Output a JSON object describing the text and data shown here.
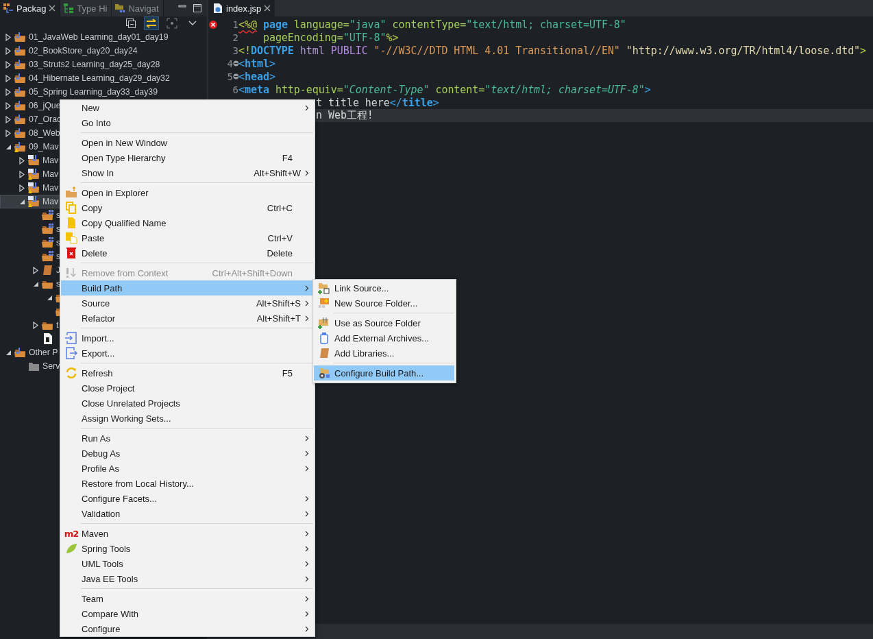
{
  "package_explorer": {
    "tabs": [
      {
        "label": "Packag",
        "selected": true,
        "closable": true
      },
      {
        "label": "Type Hi",
        "selected": false,
        "closable": false
      },
      {
        "label": "Navigat",
        "selected": false,
        "closable": false
      }
    ],
    "toolbar": [
      {
        "kind": "collapse",
        "selected": false
      },
      {
        "kind": "link",
        "selected": true
      },
      {
        "kind": "focus",
        "selected": false
      },
      {
        "kind": "menu",
        "selected": false
      }
    ],
    "tree": [
      {
        "name": "01_JavaWeb Learning_day01_day19",
        "kind": "project",
        "expanded": false,
        "selected": false
      },
      {
        "name": "02_BookStore_day20_day24",
        "kind": "project",
        "expanded": false,
        "selected": false
      },
      {
        "name": "03_Struts2 Learning_day25_day28",
        "kind": "project",
        "expanded": false,
        "selected": false
      },
      {
        "name": "04_Hibernate Learning_day29_day32",
        "kind": "project",
        "expanded": false,
        "selected": false
      },
      {
        "name": "05_Spring Learning_day33_day39",
        "kind": "project",
        "expanded": false,
        "selected": false
      },
      {
        "name": "06_jQue",
        "kind": "project",
        "expanded": false,
        "selected": false
      },
      {
        "name": "07_Orac",
        "kind": "project",
        "expanded": false,
        "selected": false
      },
      {
        "name": "08_Web",
        "kind": "project",
        "expanded": false,
        "selected": false
      },
      {
        "name": "09_Mav",
        "kind": "project",
        "warning": true,
        "expanded": true,
        "selected": false,
        "children": [
          {
            "name": "Mav",
            "kind": "maven",
            "warning": false,
            "expanded": false,
            "selected": false
          },
          {
            "name": "Mav",
            "kind": "maven",
            "warning": true,
            "expanded": false,
            "selected": false
          },
          {
            "name": "Mav",
            "kind": "maven",
            "warning": true,
            "expanded": false,
            "selected": false
          },
          {
            "name": "Mav",
            "kind": "maven",
            "warning": true,
            "expanded": true,
            "selected": true,
            "children": [
              {
                "name": "s",
                "kind": "source-folder",
                "selected": false
              },
              {
                "name": "s",
                "kind": "source-folder",
                "selected": false
              },
              {
                "name": "s",
                "kind": "source-folder",
                "selected": false
              },
              {
                "name": "s",
                "kind": "source-folder",
                "selected": false
              },
              {
                "name": "J",
                "kind": "library",
                "expanded": false,
                "selected": false
              },
              {
                "name": "s",
                "kind": "folder",
                "expanded": true,
                "selected": false,
                "children": [
                  {
                    "kind": "folder",
                    "expanded": true,
                    "selected": false
                  },
                  {
                    "kind": "folder",
                    "selected": false
                  }
                ]
              },
              {
                "name": "t",
                "kind": "folder",
                "expanded": false,
                "selected": false
              },
              {
                "kind": "file",
                "selected": false
              }
            ]
          }
        ]
      },
      {
        "name": "Other P",
        "kind": "project",
        "expanded": true,
        "selected": false,
        "children": [
          {
            "name": "Serv",
            "kind": "grey-folder",
            "selected": false
          }
        ]
      }
    ]
  },
  "editor": {
    "tabs": [
      {
        "label": "index.jsp",
        "selected": true
      }
    ],
    "lines": [
      {
        "kind": "full",
        "number": "1",
        "error": true,
        "foldable": false,
        "current": false,
        "tokens": [
          {
            "t": "<%@",
            "kind": "delim"
          },
          {
            "t": " page",
            "kind": "keyword"
          },
          {
            "t": " language=",
            "kind": "attr"
          },
          {
            "t": "\"java\"",
            "kind": "value"
          },
          {
            "t": " contentType=",
            "kind": "attr"
          },
          {
            "t": "\"text/html; charset=UTF-8\"",
            "kind": "value"
          }
        ]
      },
      {
        "kind": "full",
        "number": "2",
        "error": false,
        "foldable": false,
        "current": false,
        "tokens": [
          {
            "t": "    pageEncoding=",
            "kind": "attr"
          },
          {
            "t": "\"UTF-8\"",
            "kind": "value"
          },
          {
            "t": "%>",
            "kind": "delim"
          }
        ]
      },
      {
        "kind": "full",
        "number": "3",
        "error": false,
        "foldable": false,
        "current": false,
        "tokens": [
          {
            "t": "<!",
            "kind": "delim"
          },
          {
            "t": "DOCTYPE",
            "kind": "keyword"
          },
          {
            "t": " html",
            "kind": "doctype"
          },
          {
            "t": " PUBLIC",
            "kind": "public"
          },
          {
            "t": " \"-//W3C//DTD HTML 4.01 Transitional//EN\"",
            "kind": "string"
          },
          {
            "t": " \"http://www.w3.org/TR/html4/loose.dtd\"",
            "kind": "url"
          },
          {
            "t": ">",
            "kind": "delim"
          }
        ]
      },
      {
        "kind": "full",
        "number": "4",
        "error": false,
        "foldable": true,
        "current": false,
        "tokens": [
          {
            "t": "<",
            "kind": "bracket"
          },
          {
            "t": "html",
            "kind": "tag"
          },
          {
            "t": ">",
            "kind": "bracket"
          }
        ]
      },
      {
        "kind": "full",
        "number": "5",
        "error": false,
        "foldable": true,
        "current": false,
        "tokens": [
          {
            "t": "<",
            "kind": "bracket"
          },
          {
            "t": "head",
            "kind": "tag"
          },
          {
            "t": ">",
            "kind": "bracket"
          }
        ]
      },
      {
        "kind": "full",
        "number": "6",
        "error": false,
        "foldable": false,
        "current": false,
        "tokens": [
          {
            "t": "<",
            "kind": "bracket"
          },
          {
            "t": "meta",
            "kind": "tag"
          },
          {
            "t": " http-equiv=",
            "kind": "attr"
          },
          {
            "t": "\"Content-Type\"",
            "kind": "ivalue"
          },
          {
            "t": " content=",
            "kind": "attr"
          },
          {
            "t": "\"text/html; charset=UTF-8\"",
            "kind": "ivalue"
          },
          {
            "t": ">",
            "kind": "bracket"
          }
        ]
      },
      {
        "kind": "partial",
        "error": false,
        "foldable": false,
        "current": false,
        "tokens": [
          {
            "t": "t title here",
            "kind": "text"
          },
          {
            "t": "</",
            "kind": "bracket"
          },
          {
            "t": "title",
            "kind": "tag"
          },
          {
            "t": ">",
            "kind": "bracket"
          }
        ]
      },
      {
        "kind": "partial",
        "error": false,
        "foldable": false,
        "current": true,
        "tokens": [
          {
            "t": "n Web工程!",
            "kind": "text"
          }
        ]
      }
    ]
  },
  "context_menu": [
    {
      "kind": "item",
      "label": "New",
      "submenu": true,
      "disabled": false,
      "selected": false
    },
    {
      "kind": "item",
      "label": "Go Into",
      "submenu": false,
      "disabled": false,
      "selected": false
    },
    {
      "kind": "separator"
    },
    {
      "kind": "item",
      "label": "Open in New Window",
      "submenu": false,
      "disabled": false,
      "selected": false
    },
    {
      "kind": "item",
      "label": "Open Type Hierarchy",
      "shortcut": "F4",
      "submenu": false,
      "disabled": false,
      "selected": false
    },
    {
      "kind": "item",
      "label": "Show In",
      "shortcut": "Alt+Shift+W",
      "submenu": true,
      "disabled": false,
      "selected": false
    },
    {
      "kind": "separator"
    },
    {
      "kind": "item",
      "label": "Open in Explorer",
      "submenu": false,
      "disabled": false,
      "selected": false
    },
    {
      "kind": "item",
      "label": "Copy",
      "shortcut": "Ctrl+C",
      "submenu": false,
      "disabled": false,
      "selected": false
    },
    {
      "kind": "item",
      "label": "Copy Qualified Name",
      "submenu": false,
      "disabled": false,
      "selected": false
    },
    {
      "kind": "item",
      "label": "Paste",
      "shortcut": "Ctrl+V",
      "submenu": false,
      "disabled": false,
      "selected": false
    },
    {
      "kind": "item",
      "label": "Delete",
      "shortcut": "Delete",
      "submenu": false,
      "disabled": false,
      "selected": false
    },
    {
      "kind": "separator"
    },
    {
      "kind": "item",
      "label": "Remove from Context",
      "shortcut": "Ctrl+Alt+Shift+Down",
      "submenu": false,
      "disabled": true,
      "selected": false
    },
    {
      "kind": "item",
      "label": "Build Path",
      "submenu": true,
      "disabled": false,
      "selected": true
    },
    {
      "kind": "item",
      "label": "Source",
      "shortcut": "Alt+Shift+S",
      "submenu": true,
      "disabled": false,
      "selected": false
    },
    {
      "kind": "item",
      "label": "Refactor",
      "shortcut": "Alt+Shift+T",
      "submenu": true,
      "disabled": false,
      "selected": false
    },
    {
      "kind": "separator"
    },
    {
      "kind": "item",
      "label": "Import...",
      "submenu": false,
      "disabled": false,
      "selected": false
    },
    {
      "kind": "item",
      "label": "Export...",
      "submenu": false,
      "disabled": false,
      "selected": false
    },
    {
      "kind": "separator"
    },
    {
      "kind": "item",
      "label": "Refresh",
      "shortcut": "F5",
      "submenu": false,
      "disabled": false,
      "selected": false
    },
    {
      "kind": "item",
      "label": "Close Project",
      "submenu": false,
      "disabled": false,
      "selected": false
    },
    {
      "kind": "item",
      "label": "Close Unrelated Projects",
      "submenu": false,
      "disabled": false,
      "selected": false
    },
    {
      "kind": "item",
      "label": "Assign Working Sets...",
      "submenu": false,
      "disabled": false,
      "selected": false
    },
    {
      "kind": "separator"
    },
    {
      "kind": "item",
      "label": "Run As",
      "submenu": true,
      "disabled": false,
      "selected": false
    },
    {
      "kind": "item",
      "label": "Debug As",
      "submenu": true,
      "disabled": false,
      "selected": false
    },
    {
      "kind": "item",
      "label": "Profile As",
      "submenu": true,
      "disabled": false,
      "selected": false
    },
    {
      "kind": "item",
      "label": "Restore from Local History...",
      "submenu": false,
      "disabled": false,
      "selected": false
    },
    {
      "kind": "item",
      "label": "Configure Facets...",
      "submenu": true,
      "disabled": false,
      "selected": false
    },
    {
      "kind": "item",
      "label": "Validation",
      "submenu": true,
      "disabled": false,
      "selected": false
    },
    {
      "kind": "separator"
    },
    {
      "kind": "item",
      "label": "Maven",
      "badge": "m2",
      "submenu": true,
      "disabled": false,
      "selected": false
    },
    {
      "kind": "item",
      "label": "Spring Tools",
      "submenu": true,
      "disabled": false,
      "selected": false
    },
    {
      "kind": "item",
      "label": "UML Tools",
      "submenu": true,
      "disabled": false,
      "selected": false
    },
    {
      "kind": "item",
      "label": "Java EE Tools",
      "submenu": true,
      "disabled": false,
      "selected": false
    },
    {
      "kind": "separator"
    },
    {
      "kind": "item",
      "label": "Team",
      "submenu": true,
      "disabled": false,
      "selected": false
    },
    {
      "kind": "item",
      "label": "Compare With",
      "submenu": true,
      "disabled": false,
      "selected": false
    },
    {
      "kind": "item",
      "label": "Configure",
      "submenu": true,
      "disabled": false,
      "selected": false
    }
  ],
  "build_path_submenu": [
    {
      "kind": "item",
      "label": "Link Source...",
      "selected": false
    },
    {
      "kind": "item",
      "label": "New Source Folder...",
      "selected": false
    },
    {
      "kind": "separator"
    },
    {
      "kind": "item",
      "label": "Use as Source Folder",
      "selected": false
    },
    {
      "kind": "item",
      "label": "Add External Archives...",
      "selected": false
    },
    {
      "kind": "item",
      "label": "Add Libraries...",
      "selected": false
    },
    {
      "kind": "separator"
    },
    {
      "kind": "item",
      "label": "Configure Build Path...",
      "selected": true
    }
  ]
}
